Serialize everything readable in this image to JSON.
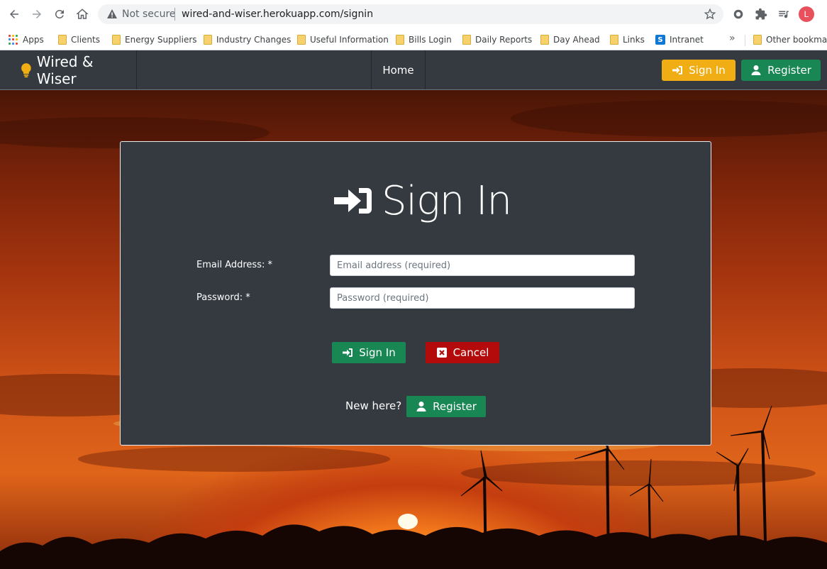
{
  "browser": {
    "security_label": "Not secure",
    "url": "wired-and-wiser.herokuapp.com/signin",
    "profile_initial": "L",
    "bookmarks": [
      {
        "label": "Apps",
        "icon": "apps-grid-icon"
      },
      {
        "label": "Clients",
        "icon": "folder-icon"
      },
      {
        "label": "Energy Suppliers",
        "icon": "folder-icon"
      },
      {
        "label": "Industry Changes",
        "icon": "folder-icon"
      },
      {
        "label": "Useful Information",
        "icon": "folder-icon"
      },
      {
        "label": "Bills Login",
        "icon": "folder-icon"
      },
      {
        "label": "Daily Reports",
        "icon": "folder-icon"
      },
      {
        "label": "Day Ahead",
        "icon": "folder-icon"
      },
      {
        "label": "Links",
        "icon": "folder-icon"
      },
      {
        "label": "Intranet",
        "icon": "sharepoint-icon"
      }
    ],
    "more_label": "»",
    "other_bookmarks": "Other bookmar"
  },
  "site": {
    "brand": "Wired & Wiser",
    "nav_home": "Home",
    "nav_signin": "Sign In",
    "nav_register": "Register",
    "colors": {
      "warning": "#f0ad14",
      "success": "#198754",
      "danger": "#b30b0b",
      "dark": "#343a40"
    }
  },
  "signin": {
    "title": "Sign In",
    "email_label": "Email Address: *",
    "email_placeholder": "Email address (required)",
    "password_label": "Password: *",
    "password_placeholder": "Password (required)",
    "submit_label": "Sign In",
    "cancel_label": "Cancel",
    "new_here": "New here?",
    "register_label": "Register"
  }
}
